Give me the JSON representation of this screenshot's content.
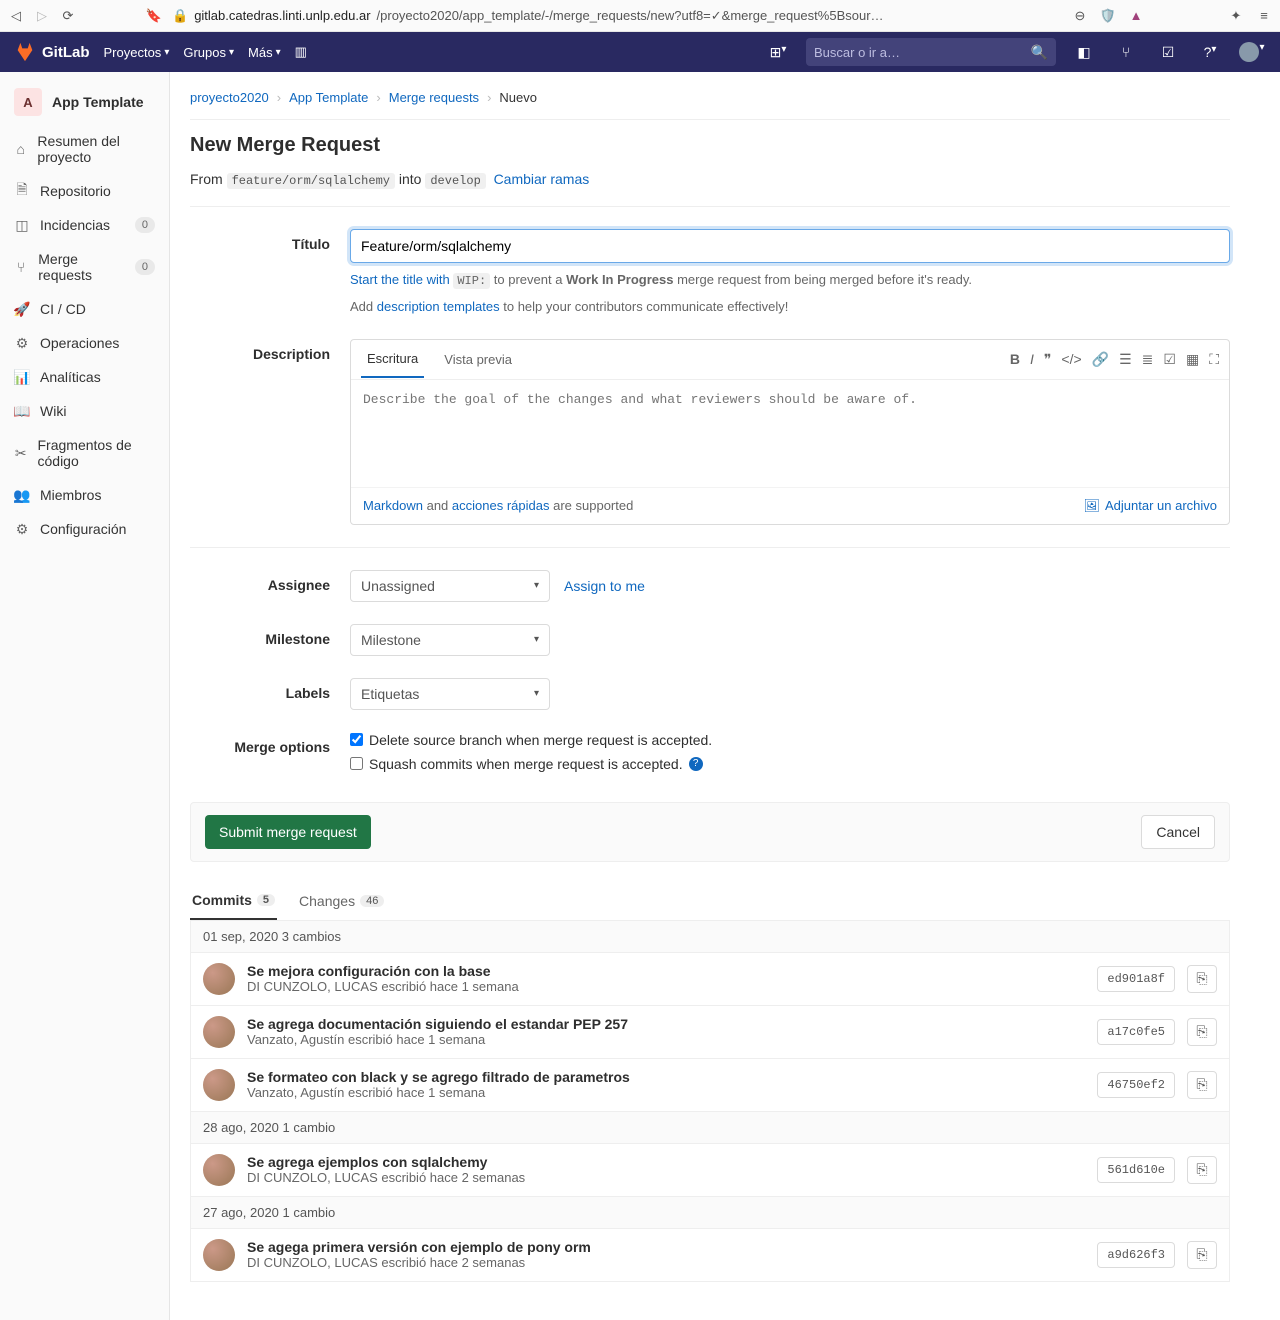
{
  "browser": {
    "url_host": "gitlab.catedras.linti.unlp.edu.ar",
    "url_path": "/proyecto2020/app_template/-/merge_requests/new?utf8=✓&merge_request%5Bsour…"
  },
  "topnav": {
    "brand": "GitLab",
    "menu": [
      "Proyectos",
      "Grupos",
      "Más"
    ],
    "search_placeholder": "Buscar o ir a…"
  },
  "sidebar": {
    "project_letter": "A",
    "project_name": "App Template",
    "items": [
      {
        "label": "Resumen del proyecto",
        "icon": "home"
      },
      {
        "label": "Repositorio",
        "icon": "file"
      },
      {
        "label": "Incidencias",
        "icon": "issue",
        "badge": "0"
      },
      {
        "label": "Merge requests",
        "icon": "merge",
        "badge": "0"
      },
      {
        "label": "CI / CD",
        "icon": "rocket"
      },
      {
        "label": "Operaciones",
        "icon": "ops"
      },
      {
        "label": "Analíticas",
        "icon": "chart"
      },
      {
        "label": "Wiki",
        "icon": "book"
      },
      {
        "label": "Fragmentos de código",
        "icon": "scissors"
      },
      {
        "label": "Miembros",
        "icon": "members"
      },
      {
        "label": "Configuración",
        "icon": "gear"
      }
    ]
  },
  "breadcrumb": [
    "proyecto2020",
    "App Template",
    "Merge requests",
    "Nuevo"
  ],
  "page": {
    "heading": "New Merge Request",
    "from_pre": "From",
    "from_branch": "feature/orm/sqlalchemy",
    "into": "into",
    "target_branch": "develop",
    "change_branches": "Cambiar ramas",
    "labels": {
      "title": "Título",
      "description": "Description",
      "assignee": "Assignee",
      "milestone": "Milestone",
      "labels": "Labels",
      "merge_options": "Merge options"
    },
    "title_value": "Feature/orm/sqlalchemy",
    "title_hint_pre": "Start the title with",
    "title_hint_code": "WIP:",
    "title_hint_mid": "to prevent a",
    "title_hint_bold": "Work In Progress",
    "title_hint_post": "merge request from being merged before it's ready.",
    "tmpl_pre": "Add",
    "tmpl_link": "description templates",
    "tmpl_post": "to help your contributors communicate effectively!",
    "editor": {
      "tab_write": "Escritura",
      "tab_preview": "Vista previa",
      "placeholder": "Describe the goal of the changes and what reviewers should be aware of.",
      "md_link": "Markdown",
      "and": "and",
      "qa_link": "acciones rápidas",
      "supported": "are supported",
      "attach": "Adjuntar un archivo"
    },
    "assignee_placeholder": "Unassigned",
    "assign_me": "Assign to me",
    "milestone_placeholder": "Milestone",
    "labels_placeholder": "Etiquetas",
    "opt_delete": "Delete source branch when merge request is accepted.",
    "opt_squash": "Squash commits when merge request is accepted.",
    "submit": "Submit merge request",
    "cancel": "Cancel"
  },
  "commits_section": {
    "tab_commits": "Commits",
    "commits_count": "5",
    "tab_changes": "Changes",
    "changes_count": "46",
    "groups": [
      {
        "header": "01 sep, 2020 3 cambios",
        "commits": [
          {
            "title": "Se mejora configuración con la base",
            "author": "DI CUNZOLO, LUCAS",
            "time": "escribió hace 1 semana",
            "sha": "ed901a8f"
          },
          {
            "title": "Se agrega documentación siguiendo el estandar PEP 257",
            "author": "Vanzato, Agustín",
            "time": "escribió hace 1 semana",
            "sha": "a17c0fe5"
          },
          {
            "title": "Se formateo con black y se agrego filtrado de parametros",
            "author": "Vanzato, Agustín",
            "time": "escribió hace 1 semana",
            "sha": "46750ef2"
          }
        ]
      },
      {
        "header": "28 ago, 2020 1 cambio",
        "commits": [
          {
            "title": "Se agrega ejemplos con sqlalchemy",
            "author": "DI CUNZOLO, LUCAS",
            "time": "escribió hace 2 semanas",
            "sha": "561d610e"
          }
        ]
      },
      {
        "header": "27 ago, 2020 1 cambio",
        "commits": [
          {
            "title": "Se agega primera versión con ejemplo de pony orm",
            "author": "DI CUNZOLO, LUCAS",
            "time": "escribió hace 2 semanas",
            "sha": "a9d626f3"
          }
        ]
      }
    ]
  }
}
